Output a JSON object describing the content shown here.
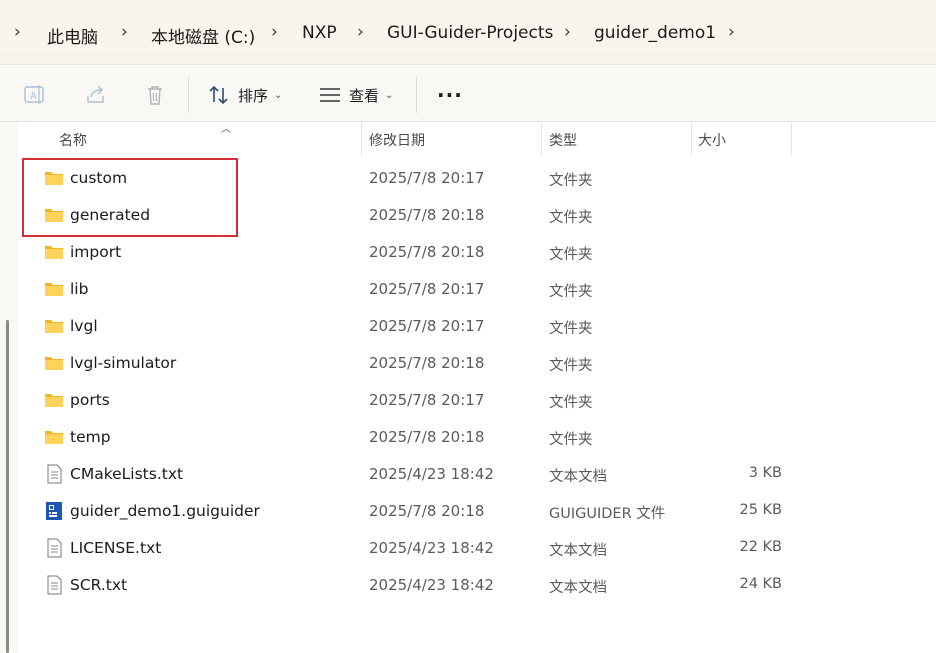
{
  "breadcrumb": {
    "items": [
      "此电脑",
      "本地磁盘 (C:)",
      "NXP",
      "GUI-Guider-Projects",
      "guider_demo1"
    ]
  },
  "toolbar": {
    "sort_label": "排序",
    "view_label": "查看",
    "more_label": "···"
  },
  "columns": {
    "name": "名称",
    "modified": "修改日期",
    "type": "类型",
    "size": "大小"
  },
  "files": [
    {
      "name": "custom",
      "modified": "2025/7/8 20:17",
      "type": "文件夹",
      "size": "",
      "icon": "folder-icon"
    },
    {
      "name": "generated",
      "modified": "2025/7/8 20:18",
      "type": "文件夹",
      "size": "",
      "icon": "folder-icon"
    },
    {
      "name": "import",
      "modified": "2025/7/8 20:18",
      "type": "文件夹",
      "size": "",
      "icon": "folder-icon"
    },
    {
      "name": "lib",
      "modified": "2025/7/8 20:17",
      "type": "文件夹",
      "size": "",
      "icon": "folder-icon"
    },
    {
      "name": "lvgl",
      "modified": "2025/7/8 20:17",
      "type": "文件夹",
      "size": "",
      "icon": "folder-icon"
    },
    {
      "name": "lvgl-simulator",
      "modified": "2025/7/8 20:18",
      "type": "文件夹",
      "size": "",
      "icon": "folder-icon"
    },
    {
      "name": "ports",
      "modified": "2025/7/8 20:17",
      "type": "文件夹",
      "size": "",
      "icon": "folder-icon"
    },
    {
      "name": "temp",
      "modified": "2025/7/8 20:18",
      "type": "文件夹",
      "size": "",
      "icon": "folder-icon"
    },
    {
      "name": "CMakeLists.txt",
      "modified": "2025/4/23 18:42",
      "type": "文本文档",
      "size": "3 KB",
      "icon": "text-file-icon"
    },
    {
      "name": "guider_demo1.guiguider",
      "modified": "2025/7/8 20:18",
      "type": "GUIGUIDER 文件",
      "size": "25 KB",
      "icon": "guiguider-file-icon"
    },
    {
      "name": "LICENSE.txt",
      "modified": "2025/4/23 18:42",
      "type": "文本文档",
      "size": "22 KB",
      "icon": "text-file-icon"
    },
    {
      "name": "SCR.txt",
      "modified": "2025/4/23 18:42",
      "type": "文本文档",
      "size": "24 KB",
      "icon": "text-file-icon"
    }
  ],
  "colors": {
    "highlight": "#d32f35",
    "folder": "#f5c445"
  }
}
